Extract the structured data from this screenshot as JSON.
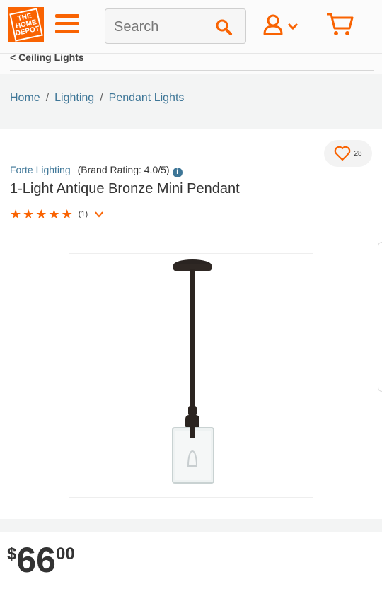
{
  "header": {
    "logo_text": "THE HOME DEPOT",
    "search_placeholder": "Search",
    "brand_color": "#f96302"
  },
  "back_link": "< Ceiling Lights",
  "breadcrumb": [
    "Home",
    "Lighting",
    "Pendant Lights"
  ],
  "breadcrumb_sep": "/",
  "product": {
    "favorites_count": "28",
    "brand": "Forte Lighting",
    "brand_rating": "(Brand Rating: 4.0/5)",
    "title": "1-Light Antique Bronze Mini Pendant",
    "rating_stars": 5,
    "review_count": "(1)"
  },
  "price": {
    "dollar_sign": "$",
    "whole": "66",
    "cents": "00"
  },
  "icons": {
    "menu": "hamburger-menu-icon",
    "search": "magnifier-icon",
    "account": "user-icon",
    "cart": "cart-icon",
    "favorite": "heart-icon",
    "info": "info-icon"
  }
}
